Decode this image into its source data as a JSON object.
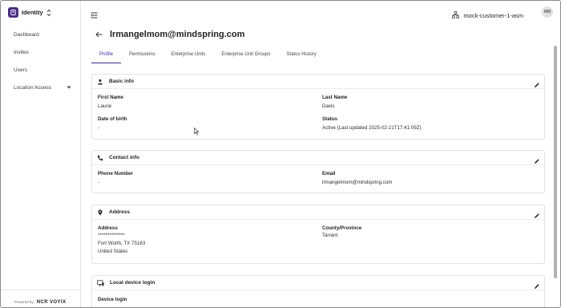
{
  "app": {
    "title": "Identity"
  },
  "sidebar": {
    "items": [
      {
        "label": "Dashboard"
      },
      {
        "label": "Invites"
      },
      {
        "label": "Users"
      },
      {
        "label": "Location Access"
      }
    ],
    "powered_by": {
      "label": "Powered by",
      "brand": "NCR VOYIX"
    }
  },
  "topbar": {
    "org_name": "mock-customer-1-asm",
    "avatar_initials": "MM"
  },
  "page": {
    "title": "lrmangelmom@mindspring.com",
    "tabs": [
      {
        "label": "Profile",
        "active": true
      },
      {
        "label": "Permissions"
      },
      {
        "label": "Enterprise Units"
      },
      {
        "label": "Enterprise Unit Groups"
      },
      {
        "label": "Status History"
      }
    ]
  },
  "basic_info": {
    "title": "Basic info",
    "first_name_label": "First Name",
    "first_name": "Laurie",
    "last_name_label": "Last Name",
    "last_name": "Davis",
    "dob_label": "Date of birth",
    "dob": "-",
    "status_label": "Status",
    "status": "Active (Last updated 2025-02-21T17:41:09Z)"
  },
  "contact_info": {
    "title": "Contact info",
    "phone_label": "Phone Number",
    "phone": "-",
    "email_label": "Email",
    "email": "lrmangelmom@mindspring.com"
  },
  "address": {
    "title": "Address",
    "address_label": "Address",
    "line1": "**************",
    "line2": "Fort Worth, TX 75163",
    "line3": "United States",
    "county_label": "County/Province",
    "county": "Tarrant"
  },
  "device_login": {
    "title": "Local device login",
    "label": "Device login"
  },
  "colors": {
    "accent": "#3b2aa8",
    "brand": "#4b2a86"
  }
}
